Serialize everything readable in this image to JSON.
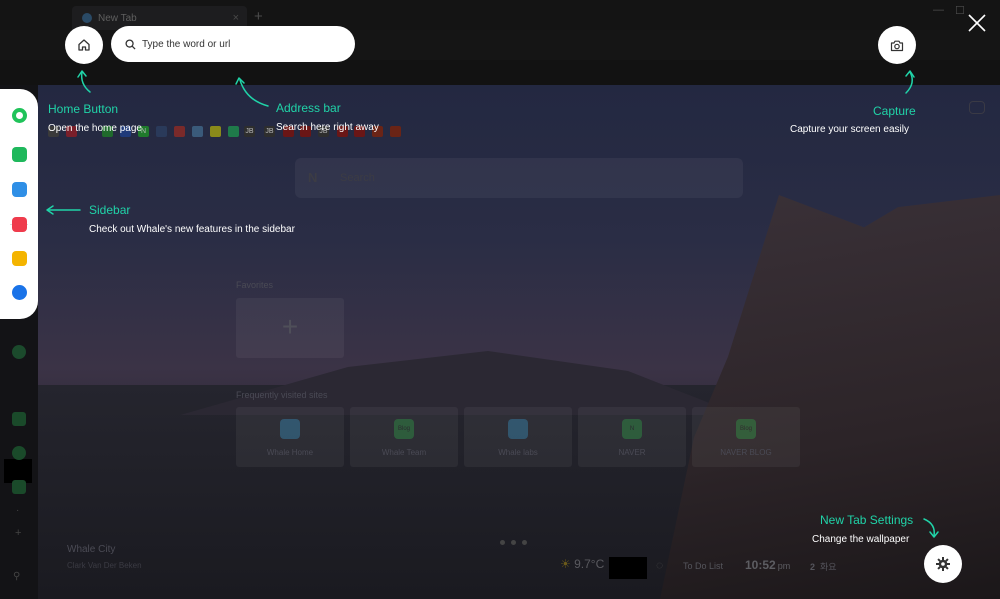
{
  "browser": {
    "tab_title": "New Tab",
    "tab_close": "×",
    "new_tab": "+"
  },
  "bookmarks": [
    "N",
    "JB",
    "JB",
    "JB"
  ],
  "overlay": {
    "address_placeholder": "Type the word or url",
    "callouts": {
      "home": {
        "title": "Home Button",
        "desc": "Open the home page"
      },
      "address": {
        "title": "Address bar",
        "desc": "Search here right away"
      },
      "capture": {
        "title": "Capture",
        "desc": "Capture your screen easily"
      },
      "sidebar": {
        "title": "Sidebar",
        "desc": "Check out Whale's new features in the sidebar"
      },
      "settings": {
        "title": "New Tab Settings",
        "desc": "Change the wallpaper"
      }
    }
  },
  "newtab": {
    "search_logo": "N",
    "search_placeholder": "Search",
    "favorites_label": "Favorites",
    "frequent_label": "Frequently visited sites",
    "frequent_sites": [
      {
        "label": "Whale Home",
        "color": "#3aa0d8",
        "icon_text": ""
      },
      {
        "label": "Whale Team",
        "color": "#2fb34a",
        "icon_text": "Blog"
      },
      {
        "label": "Whale labs",
        "color": "#3aa0d8",
        "icon_text": ""
      },
      {
        "label": "NAVER",
        "color": "#2fb34a",
        "icon_text": "N"
      },
      {
        "label": "NAVER BLOG",
        "color": "#2fb34a",
        "icon_text": "Blog"
      }
    ],
    "wallpaper_title": "Whale City",
    "wallpaper_credit": "Clark Van Der Beken",
    "temperature": "9.7°C",
    "todo": "To Do List",
    "time": "10:52",
    "time_suffix": "pm",
    "date_num": "2",
    "date_day": "화요"
  }
}
